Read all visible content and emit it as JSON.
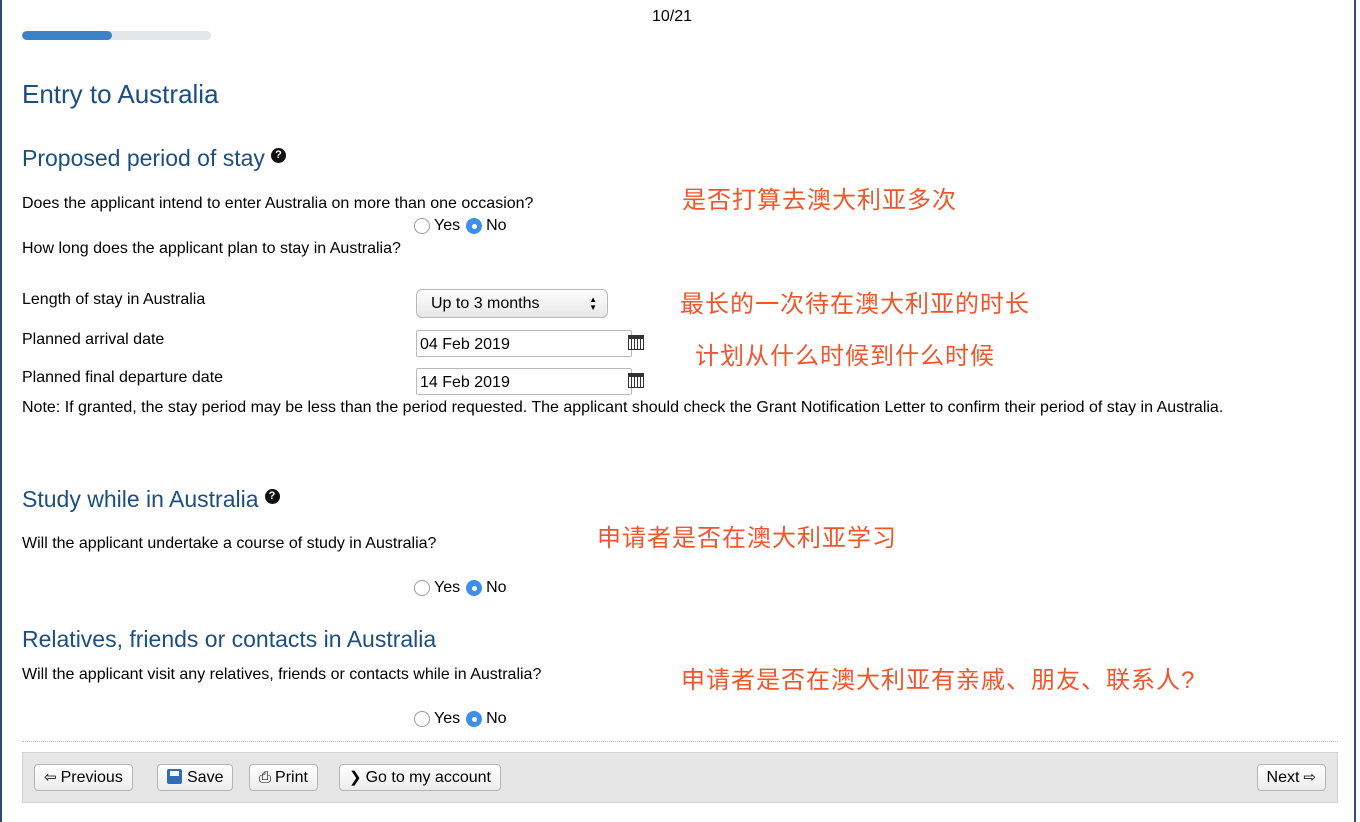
{
  "header": {
    "page_counter": "10/21",
    "progress_fraction": 0.4762
  },
  "page_title": "Entry to Australia",
  "sections": {
    "stay": {
      "heading": "Proposed period of stay",
      "q_multiple_entry": "Does the applicant intend to enter Australia on more than one occasion?",
      "q_multiple_entry_answer": "No",
      "q_how_long": "How long does the applicant plan to stay in Australia?",
      "length_label": "Length of stay in Australia",
      "length_value": "Up to 3 months",
      "arrival_label": "Planned arrival date",
      "arrival_value": "04 Feb 2019",
      "departure_label": "Planned final departure date",
      "departure_value": "14 Feb 2019",
      "note": "Note: If granted, the stay period may be less than the period requested. The applicant should check the Grant Notification Letter to confirm their period of stay in Australia."
    },
    "study": {
      "heading": "Study while in Australia",
      "question": "Will the applicant undertake a course of study in Australia?",
      "answer": "No"
    },
    "relatives": {
      "heading": "Relatives, friends or contacts in Australia",
      "question": "Will the applicant visit any relatives, friends or contacts while in Australia?",
      "answer": "No"
    }
  },
  "radio_labels": {
    "yes": "Yes",
    "no": "No"
  },
  "annotations": {
    "multiple_entry": "是否打算去澳大利亚多次",
    "length": "最长的一次待在澳大利亚的时长",
    "dates": "计划从什么时候到什么时候",
    "study": "申请者是否在澳大利亚学习",
    "relatives": "申请者是否在澳大利亚有亲戚、朋友、联系人?"
  },
  "toolbar": {
    "previous_label": "Previous",
    "save_label": "Save",
    "print_label": "Print",
    "account_label": "Go to my account",
    "next_label": "Next"
  },
  "colors": {
    "heading": "#1c4e80",
    "annotation": "#f2552c",
    "radio_selected": "#3f8fe8"
  }
}
